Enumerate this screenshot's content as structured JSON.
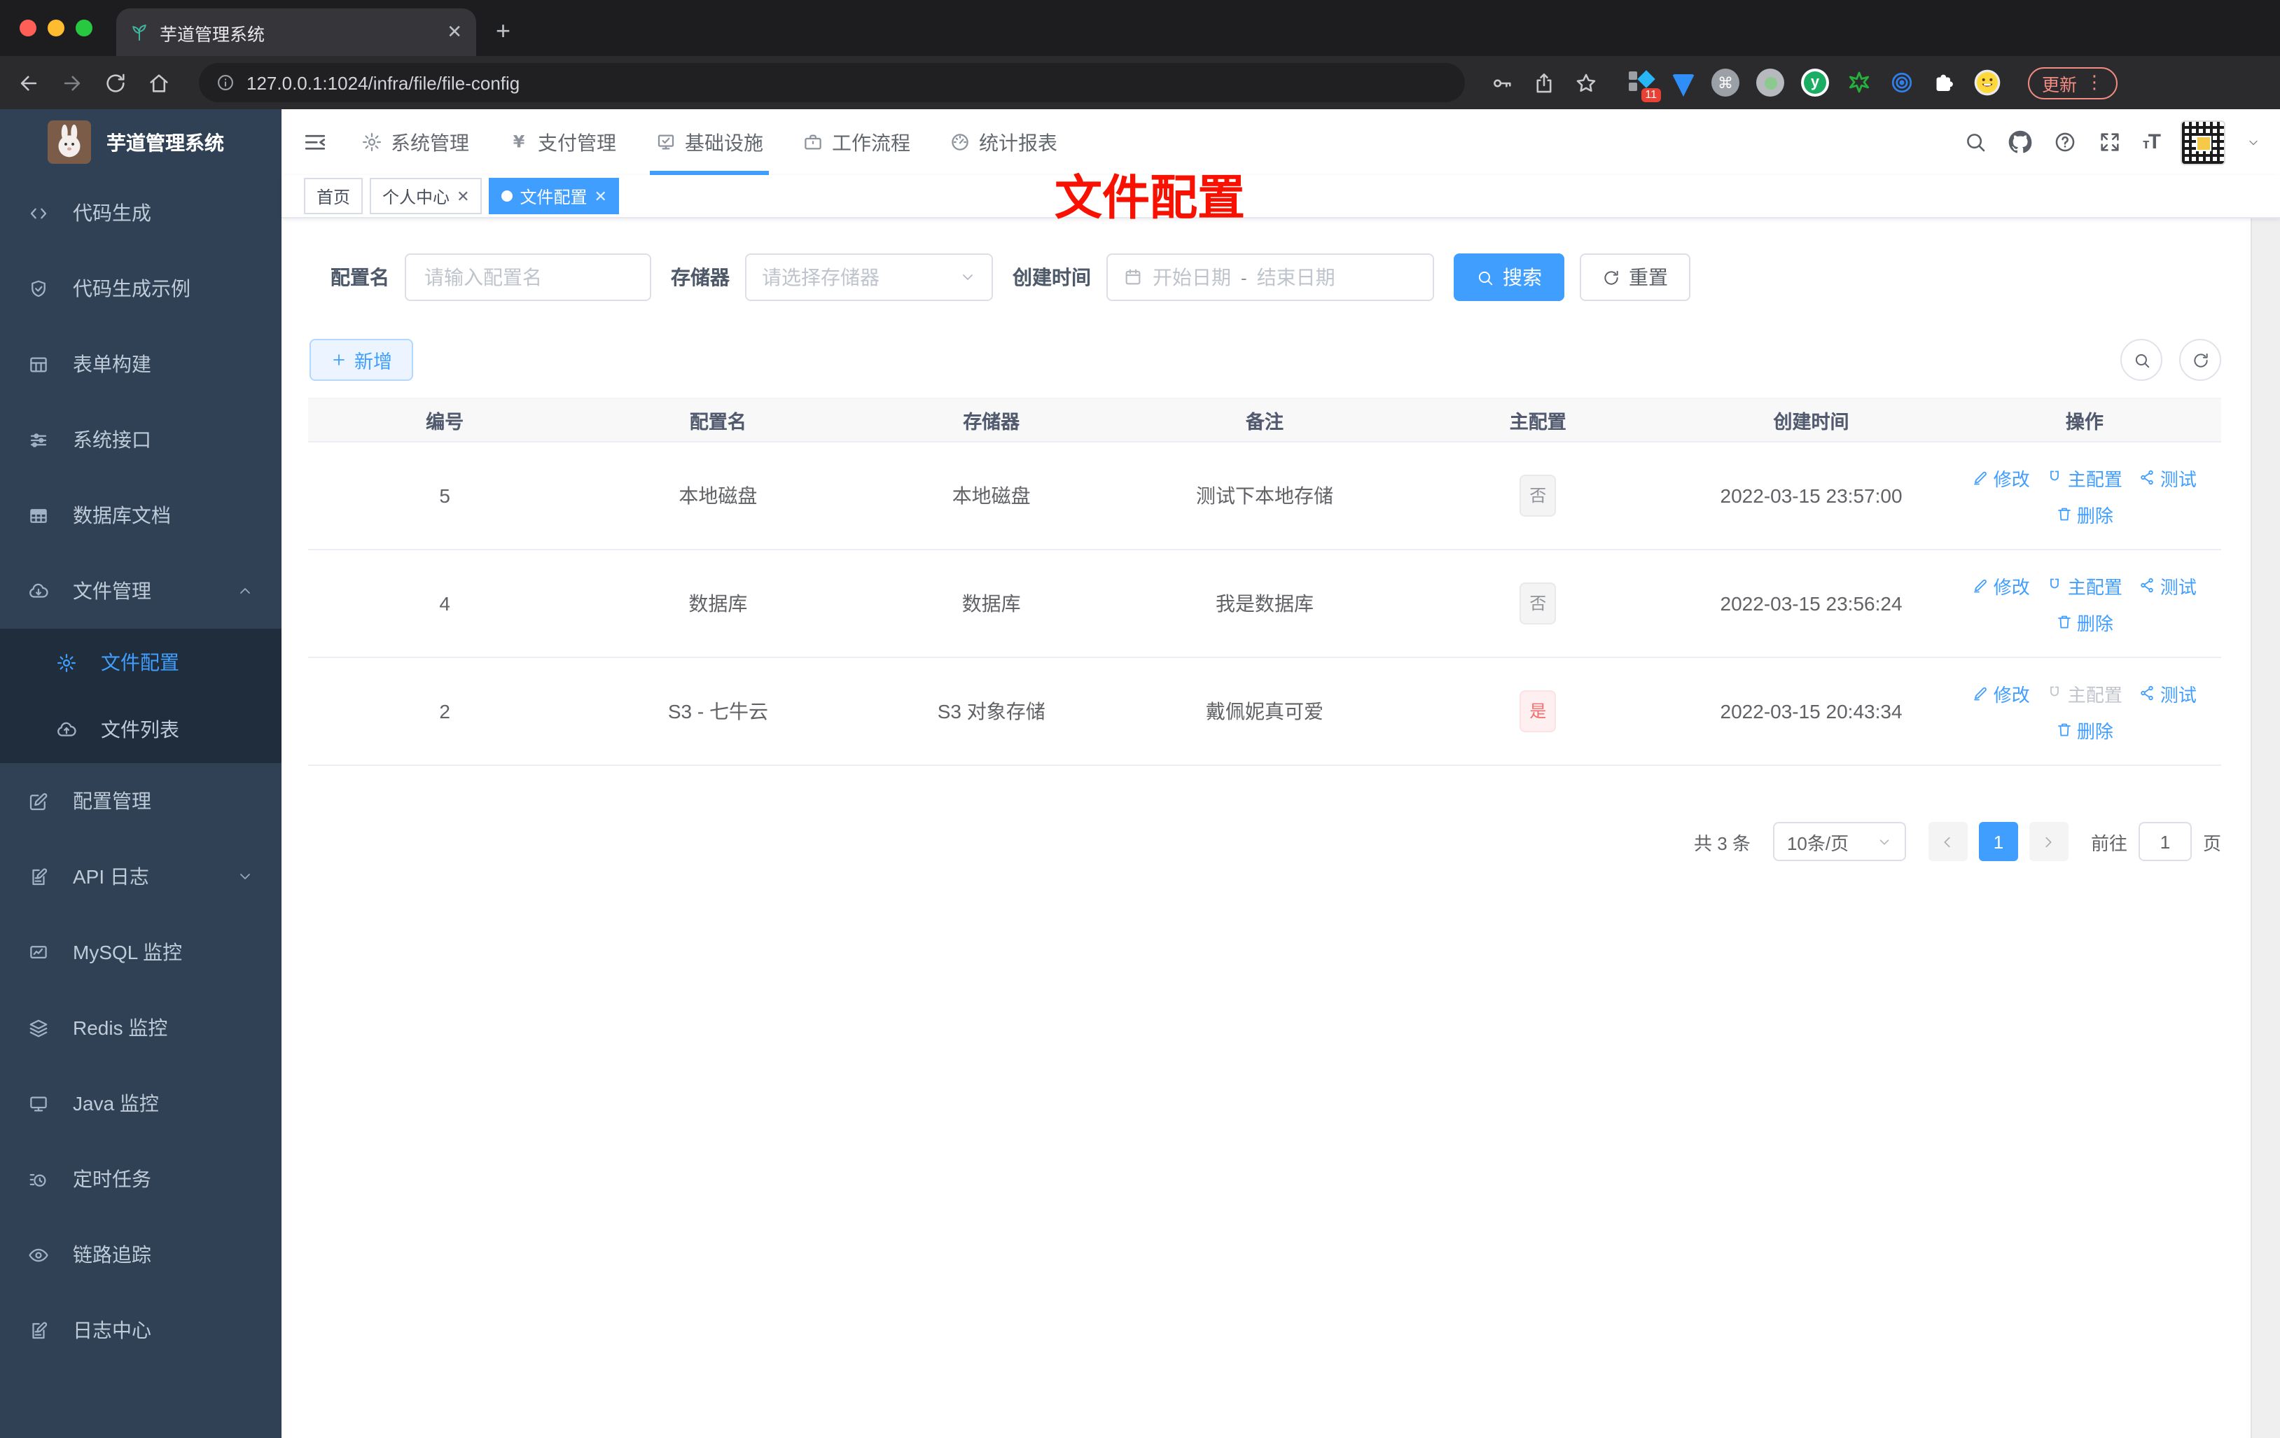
{
  "browser": {
    "tab_title": "芋道管理系统",
    "url": "127.0.0.1:1024/infra/file/file-config",
    "update_label": "更新",
    "extension_badge": "11"
  },
  "sidebar": {
    "title": "芋道管理系统",
    "items": [
      {
        "label": "代码生成",
        "icon": "code-icon"
      },
      {
        "label": "代码生成示例",
        "icon": "shield-check-icon"
      },
      {
        "label": "表单构建",
        "icon": "grid-icon"
      },
      {
        "label": "系统接口",
        "icon": "sliders-icon"
      },
      {
        "label": "数据库文档",
        "icon": "table-icon"
      },
      {
        "label": "文件管理",
        "icon": "cloud-download-icon",
        "expanded": true,
        "children": [
          {
            "label": "文件配置",
            "icon": "gear-icon",
            "active": true
          },
          {
            "label": "文件列表",
            "icon": "cloud-upload-icon",
            "active": false
          }
        ]
      },
      {
        "label": "配置管理",
        "icon": "edit-square-icon"
      },
      {
        "label": "API 日志",
        "icon": "doc-edit-icon",
        "expanded": false,
        "collapsible": true
      },
      {
        "label": "MySQL 监控",
        "icon": "monitor-chart-icon"
      },
      {
        "label": "Redis 监控",
        "icon": "layers-icon"
      },
      {
        "label": "Java 监控",
        "icon": "screen-icon"
      },
      {
        "label": "定时任务",
        "icon": "schedule-icon"
      },
      {
        "label": "链路追踪",
        "icon": "eye-icon"
      },
      {
        "label": "日志中心",
        "icon": "doc-edit-icon"
      }
    ]
  },
  "topnav": {
    "items": [
      {
        "label": "系统管理",
        "icon": "gear-icon",
        "active": false
      },
      {
        "label": "支付管理",
        "icon": "yen-icon",
        "active": false
      },
      {
        "label": "基础设施",
        "icon": "infra-monitor-icon",
        "active": true
      },
      {
        "label": "工作流程",
        "icon": "briefcase-icon",
        "active": false
      },
      {
        "label": "统计报表",
        "icon": "dashboard-icon",
        "active": false
      }
    ]
  },
  "tags": [
    {
      "label": "首页",
      "closable": false,
      "active": false
    },
    {
      "label": "个人中心",
      "closable": true,
      "active": false
    },
    {
      "label": "文件配置",
      "closable": true,
      "active": true
    }
  ],
  "annotation": {
    "title": "文件配置",
    "color": "#f81000"
  },
  "filters": {
    "config_name_label": "配置名",
    "config_name_placeholder": "请输入配置名",
    "storage_label": "存储器",
    "storage_placeholder": "请选择存储器",
    "create_time_label": "创建时间",
    "date_start_placeholder": "开始日期",
    "date_separator": "-",
    "date_end_placeholder": "结束日期",
    "search_label": "搜索",
    "reset_label": "重置"
  },
  "toolbar": {
    "add_label": "新增"
  },
  "table": {
    "columns": [
      "编号",
      "配置名",
      "存储器",
      "备注",
      "主配置",
      "创建时间",
      "操作"
    ],
    "actions": {
      "edit": "修改",
      "master": "主配置",
      "test": "测试",
      "delete": "删除"
    },
    "rows": [
      {
        "id": "5",
        "name": "本地磁盘",
        "storage": "本地磁盘",
        "remark": "测试下本地存储",
        "master": "否",
        "master_type": "info",
        "time": "2022-03-15 23:57:00",
        "master_action_disabled": false
      },
      {
        "id": "4",
        "name": "数据库",
        "storage": "数据库",
        "remark": "我是数据库",
        "master": "否",
        "master_type": "info",
        "time": "2022-03-15 23:56:24",
        "master_action_disabled": false
      },
      {
        "id": "2",
        "name": "S3 - 七牛云",
        "storage": "S3 对象存储",
        "remark": "戴佩妮真可爱",
        "master": "是",
        "master_type": "danger",
        "time": "2022-03-15 20:43:34",
        "master_action_disabled": true
      }
    ]
  },
  "pagination": {
    "total_label": "共 3 条",
    "page_size": "10条/页",
    "current_page": "1",
    "goto_label": "前往",
    "goto_value": "1",
    "page_suffix": "页"
  },
  "colors": {
    "accent": "#409eff",
    "danger": "#f56c6c",
    "sidebar_bg": "#304156",
    "submenu_bg": "#1f2d3d"
  }
}
